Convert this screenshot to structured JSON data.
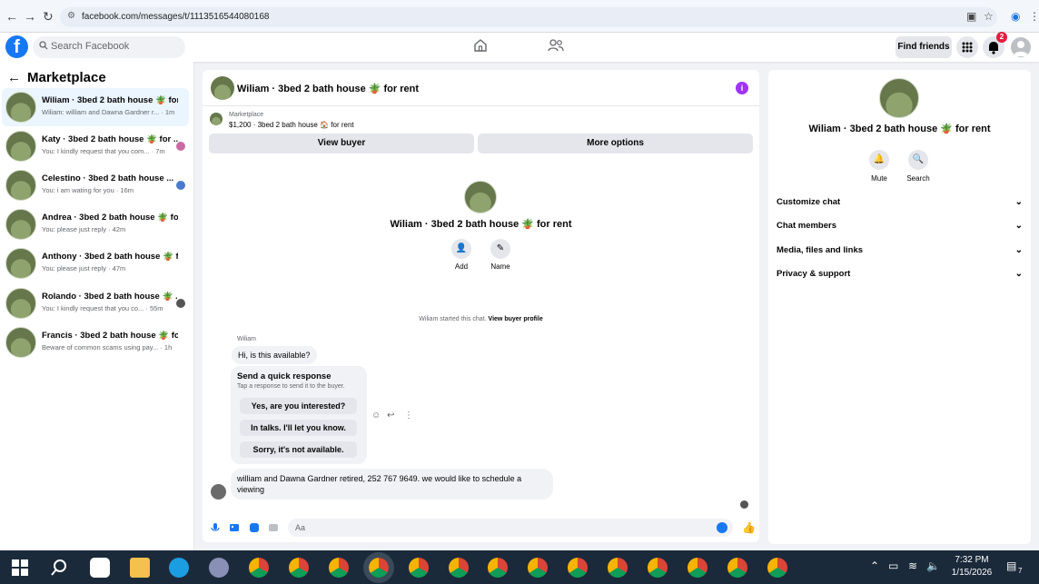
{
  "browser": {
    "url": "facebook.com/messages/t/1113516544080168",
    "back_icon": "←",
    "forward_icon": "→",
    "reload_icon": "↻",
    "tune_icon": "⚙",
    "cast_icon": "▣",
    "star_icon": "☆",
    "profile_icon": "◉",
    "menu_icon": "⋮"
  },
  "header": {
    "logo": "f",
    "search_placeholder": "Search Facebook",
    "find_friends": "Find friends",
    "notification_count": "2",
    "colors": {
      "brand": "#1877f2",
      "badge": "#e41e3f"
    }
  },
  "sidebar": {
    "title": "Marketplace",
    "conversations": [
      {
        "name": "Wiliam · 3bed 2 bath house 🪴 for...",
        "preview": "Wiliam: william and Dawna Gardner r... · 1m",
        "active": true
      },
      {
        "name": "Katy · 3bed 2 bath house 🪴 for ...",
        "preview": "You: I kindly request that you com... · 7m"
      },
      {
        "name": "Celestino · 3bed 2 bath house ...",
        "preview": "You: i am wating for you · 16m"
      },
      {
        "name": "Andrea · 3bed 2 bath house 🪴 for...",
        "preview": "You: please just reply · 42m"
      },
      {
        "name": "Anthony · 3bed 2 bath house 🪴 f...",
        "preview": "You: please just reply · 47m"
      },
      {
        "name": "Rolando · 3bed 2 bath house 🪴 ...",
        "preview": "You: I kindly request that you co... · 55m"
      },
      {
        "name": "Francis · 3bed 2 bath house 🪴 for...",
        "preview": "Beware of common scams using pay... · 1h"
      }
    ]
  },
  "chat": {
    "title": "Wiliam · 3bed 2 bath house 🪴 for rent",
    "marketplace_label": "Marketplace",
    "listing": "$1,200 · 3bed 2 bath house 🏠 for rent",
    "view_buyer": "View buyer",
    "more_options": "More options",
    "center_name": "Wiliam · 3bed 2 bath house 🪴 for rent",
    "add_label": "Add",
    "name_label": "Name",
    "system_text": "Wiliam started this chat.",
    "system_link": "View buyer profile",
    "sender": "Wiliam",
    "msg1": "Hi, is this available?",
    "quick_title": "Send a quick response",
    "quick_subtitle": "Tap a response to send it to the buyer.",
    "quick_options": [
      "Yes, are you interested?",
      "In talks. I'll let you know.",
      "Sorry, it's not available."
    ],
    "msg2": "william and Dawna Gardner retired, 252 767 9649. we would like to schedule a viewing",
    "composer_placeholder": "Aa"
  },
  "right_panel": {
    "name": "Wiliam · 3bed 2 bath house 🪴 for rent",
    "mute": "Mute",
    "search": "Search",
    "rows": [
      "Customize chat",
      "Chat members",
      "Media, files and links",
      "Privacy & support"
    ]
  },
  "taskbar": {
    "time": "7:32 PM",
    "date": "1/15/2026",
    "notif_count": "7"
  }
}
